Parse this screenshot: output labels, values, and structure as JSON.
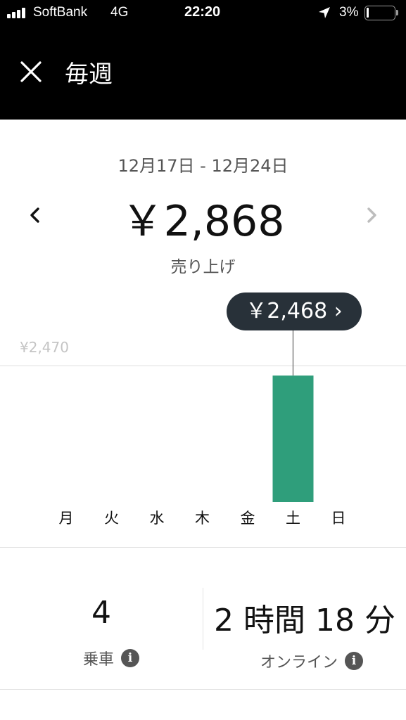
{
  "status_bar": {
    "carrier": "SoftBank",
    "network": "4G",
    "time": "22:20",
    "battery_percent": "3%",
    "icons": [
      "signal-bars-icon",
      "location-arrow-icon",
      "battery-icon"
    ]
  },
  "header": {
    "title": "毎週",
    "close_icon": "close-icon"
  },
  "summary": {
    "date_range": "12月17日 - 12月24日",
    "amount": "￥2,868",
    "amount_label": "売り上げ",
    "prev_icon": "chevron-left-icon",
    "next_icon": "chevron-right-icon"
  },
  "chart": {
    "tooltip": "￥2,468 ›"
  },
  "chart_data": {
    "type": "bar",
    "categories": [
      "月",
      "火",
      "水",
      "木",
      "金",
      "土",
      "日"
    ],
    "values": [
      0,
      0,
      0,
      0,
      0,
      2468,
      0
    ],
    "reference_label": "¥2,470",
    "reference_value": 2470,
    "ylim": [
      0,
      2470
    ],
    "highlighted_index": 5,
    "bar_color": "#2f9e7b",
    "grid": false
  },
  "stats": {
    "trips": {
      "value": "4",
      "label": "乗車"
    },
    "online": {
      "value": "2 時間 18 分",
      "label": "オンライン"
    }
  },
  "colors": {
    "header_bg": "#000000",
    "tooltip_bg": "#283139",
    "bar": "#2f9e7b",
    "muted_text": "#555555",
    "divider": "#e2e2e2"
  }
}
